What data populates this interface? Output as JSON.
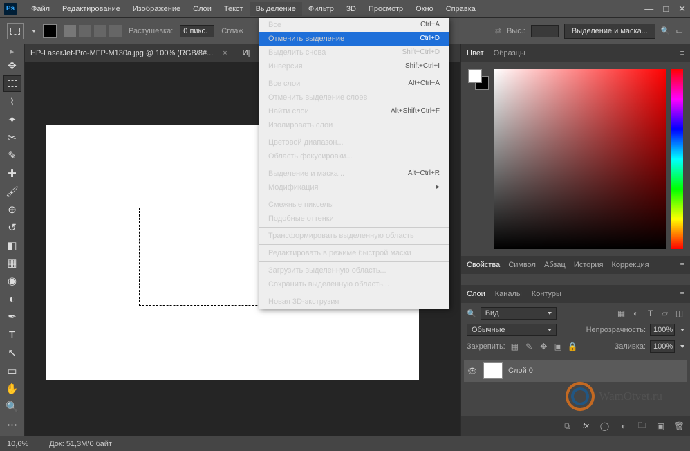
{
  "app": {
    "logo": "Ps"
  },
  "menu": [
    "Файл",
    "Редактирование",
    "Изображение",
    "Слои",
    "Текст",
    "Выделение",
    "Фильтр",
    "3D",
    "Просмотр",
    "Окно",
    "Справка"
  ],
  "menuOpenIndex": 5,
  "optbar": {
    "feather_label": "Растушевка:",
    "feather_value": "0 пикс.",
    "smooth_label": "Сглаж",
    "height_label": "Выс.:",
    "mask_btn": "Выделение и маска..."
  },
  "doc": {
    "title": "HP-LaserJet-Pro-MFP-M130a.jpg @ 100% (RGB/8#...",
    "close": "×",
    "il": "И|"
  },
  "dropdown": [
    {
      "l": "Все",
      "s": "Ctrl+A"
    },
    {
      "l": "Отменить выделение",
      "s": "Ctrl+D",
      "hi": true
    },
    {
      "l": "Выделить снова",
      "s": "Shift+Ctrl+D",
      "dis": true
    },
    {
      "l": "Инверсия",
      "s": "Shift+Ctrl+I"
    },
    {
      "sep": true
    },
    {
      "l": "Все слои",
      "s": "Alt+Ctrl+A"
    },
    {
      "l": "Отменить выделение слоев"
    },
    {
      "l": "Найти слои",
      "s": "Alt+Shift+Ctrl+F"
    },
    {
      "l": "Изолировать слои"
    },
    {
      "sep": true
    },
    {
      "l": "Цветовой диапазон..."
    },
    {
      "l": "Область фокусировки..."
    },
    {
      "sep": true
    },
    {
      "l": "Выделение и маска...",
      "s": "Alt+Ctrl+R"
    },
    {
      "l": "Модификация",
      "sub": true
    },
    {
      "sep": true
    },
    {
      "l": "Смежные пикселы"
    },
    {
      "l": "Подобные оттенки"
    },
    {
      "sep": true
    },
    {
      "l": "Трансформировать выделенную область"
    },
    {
      "sep": true
    },
    {
      "l": "Редактировать в режиме быстрой маски"
    },
    {
      "sep": true
    },
    {
      "l": "Загрузить выделенную область..."
    },
    {
      "l": "Сохранить выделенную область..."
    },
    {
      "sep": true
    },
    {
      "l": "Новая 3D-экструзия",
      "dis": true
    }
  ],
  "colorTabs": [
    "Цвет",
    "Образцы"
  ],
  "midTabs": [
    "Свойства",
    "Символ",
    "Абзац",
    "История",
    "Коррекция"
  ],
  "layerTabs": [
    "Слои",
    "Каналы",
    "Контуры"
  ],
  "layerPanel": {
    "kind": "Вид",
    "blend": "Обычные",
    "opacity_label": "Непрозрачность:",
    "opacity": "100%",
    "lock_label": "Закрепить:",
    "fill_label": "Заливка:",
    "fill": "100%",
    "layer0": "Слой 0"
  },
  "status": {
    "zoom": "10,6%",
    "docinfo": "Док: 51,3M/0 байт"
  },
  "watermark": "WamOtvet.ru",
  "icons": {
    "search": "🔍"
  }
}
